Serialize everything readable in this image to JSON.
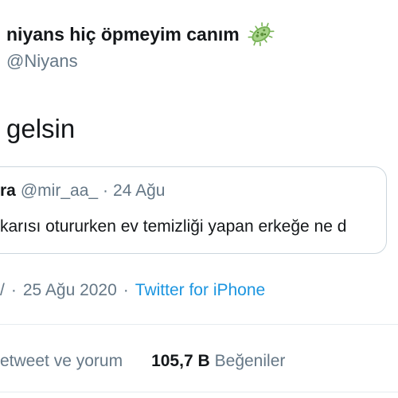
{
  "author": {
    "display_name": "niyans hiç öpmeyim canım",
    "emoji_icon": "microbe-icon",
    "handle": "@Niyans"
  },
  "tweet": {
    "text": "gelsin"
  },
  "quoted_tweet": {
    "name": "ra",
    "handle": "@mir_aa_",
    "separator": "·",
    "date": "24 Ağu",
    "text": "karısı otururken ev temizliği yapan erkeğe ne d"
  },
  "meta": {
    "time_fragment": "/",
    "separator1": "·",
    "date": "25 Ağu 2020",
    "separator2": "·",
    "source": "Twitter for iPhone"
  },
  "stats": {
    "retweets_label": "etweet ve yorum",
    "likes_count": "105,7 B",
    "likes_label": "Beğeniler"
  },
  "colors": {
    "text": "#14171a",
    "secondary": "#657786",
    "link": "#1b95e0",
    "border": "#ccd6dd"
  }
}
